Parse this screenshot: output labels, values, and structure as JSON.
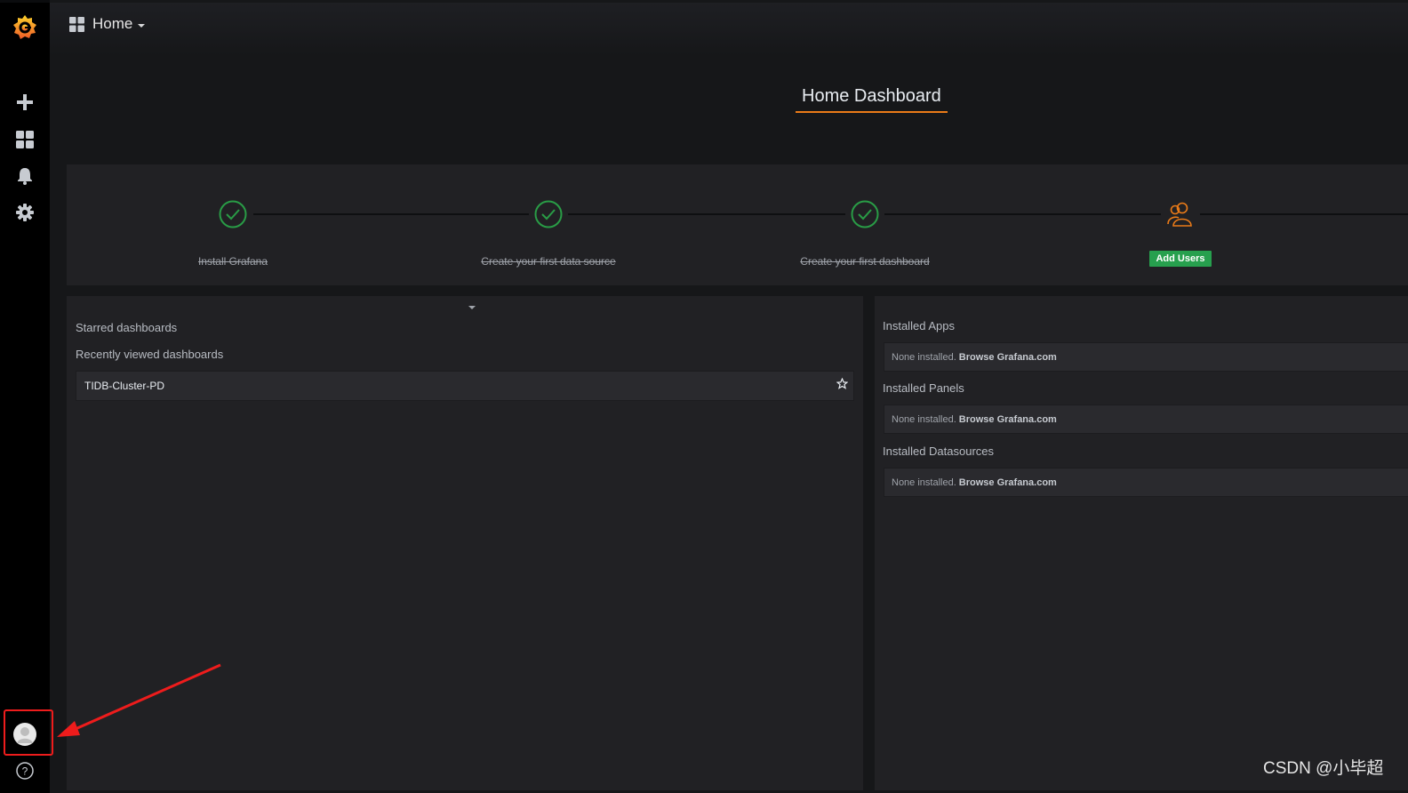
{
  "topbar": {
    "home_label": "Home"
  },
  "header": {
    "title": "Home Dashboard"
  },
  "getting_started": {
    "steps": [
      {
        "label": "Install Grafana",
        "done": true
      },
      {
        "label": "Create your first data source",
        "done": true
      },
      {
        "label": "Create your first dashboard",
        "done": true
      },
      {
        "label": "Add Users",
        "done": false
      }
    ],
    "colors": {
      "done": "#299c46",
      "pending": "#eb7b18",
      "button": "#27a04e"
    }
  },
  "left_panel": {
    "starred_heading": "Starred dashboards",
    "recent_heading": "Recently viewed dashboards",
    "recent": [
      {
        "name": "TIDB-Cluster-PD"
      }
    ]
  },
  "right_panel": {
    "sections": [
      {
        "heading": "Installed Apps",
        "none_text": "None installed.",
        "link": "Browse Grafana.com"
      },
      {
        "heading": "Installed Panels",
        "none_text": "None installed.",
        "link": "Browse Grafana.com"
      },
      {
        "heading": "Installed Datasources",
        "none_text": "None installed.",
        "link": "Browse Grafana.com"
      }
    ]
  },
  "sidebar": {
    "icons": [
      "grafana-logo-icon",
      "plus-icon",
      "dashboards-icon",
      "bell-icon",
      "gear-icon",
      "user-avatar-icon",
      "help-icon"
    ]
  },
  "watermark": "CSDN @小毕超"
}
